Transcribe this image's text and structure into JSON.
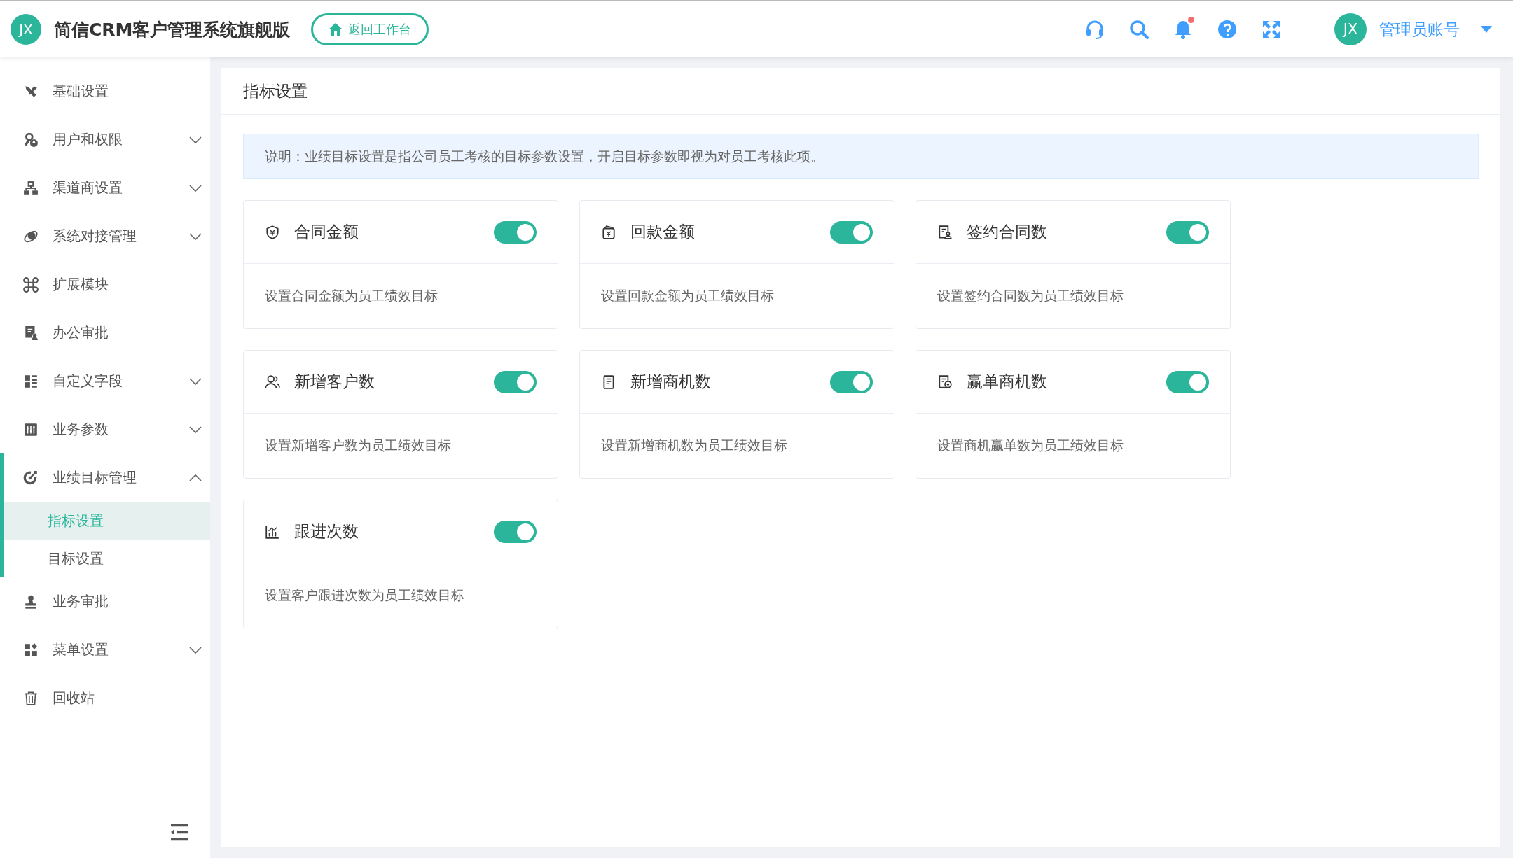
{
  "header": {
    "logo": "JX",
    "title": "简信CRM客户管理系统旗舰版",
    "home_button": "返回工作台",
    "avatar": "JX",
    "user": "管理员账号"
  },
  "sidebar": {
    "items": [
      {
        "label": "基础设置",
        "selected": false
      },
      {
        "label": "用户和权限",
        "expanded": false
      },
      {
        "label": "渠道商设置",
        "expanded": false
      },
      {
        "label": "系统对接管理",
        "expanded": false
      },
      {
        "label": "扩展模块",
        "selected": false
      },
      {
        "label": "办公审批",
        "selected": false
      },
      {
        "label": "自定义字段",
        "expanded": false
      },
      {
        "label": "业务参数",
        "expanded": false
      },
      {
        "label": "业绩目标管理",
        "expanded": true,
        "children": [
          {
            "label": "指标设置",
            "selected": true
          },
          {
            "label": "目标设置",
            "selected": false
          }
        ]
      },
      {
        "label": "业务审批",
        "selected": false
      },
      {
        "label": "菜单设置",
        "expanded": false
      },
      {
        "label": "回收站",
        "selected": false
      }
    ]
  },
  "panel": {
    "title": "指标设置",
    "notice": "说明：业绩目标设置是指公司员工考核的目标参数设置，开启目标参数即视为对员工考核此项。",
    "cards": [
      {
        "title": "合同金额",
        "on": true,
        "description": "设置合同金额为员工绩效目标"
      },
      {
        "title": "回款金额",
        "on": true,
        "description": "设置回款金额为员工绩效目标"
      },
      {
        "title": "签约合同数",
        "on": true,
        "description": "设置签约合同数为员工绩效目标"
      },
      {
        "title": "新增客户数",
        "on": true,
        "description": "设置新增客户数为员工绩效目标"
      },
      {
        "title": "新增商机数",
        "on": true,
        "description": "设置新增商机数为员工绩效目标"
      },
      {
        "title": "赢单商机数",
        "on": true,
        "description": "设置商机赢单数为员工绩效目标"
      },
      {
        "title": "跟进次数",
        "on": true,
        "description": "设置客户跟进次数为员工绩效目标"
      }
    ]
  }
}
